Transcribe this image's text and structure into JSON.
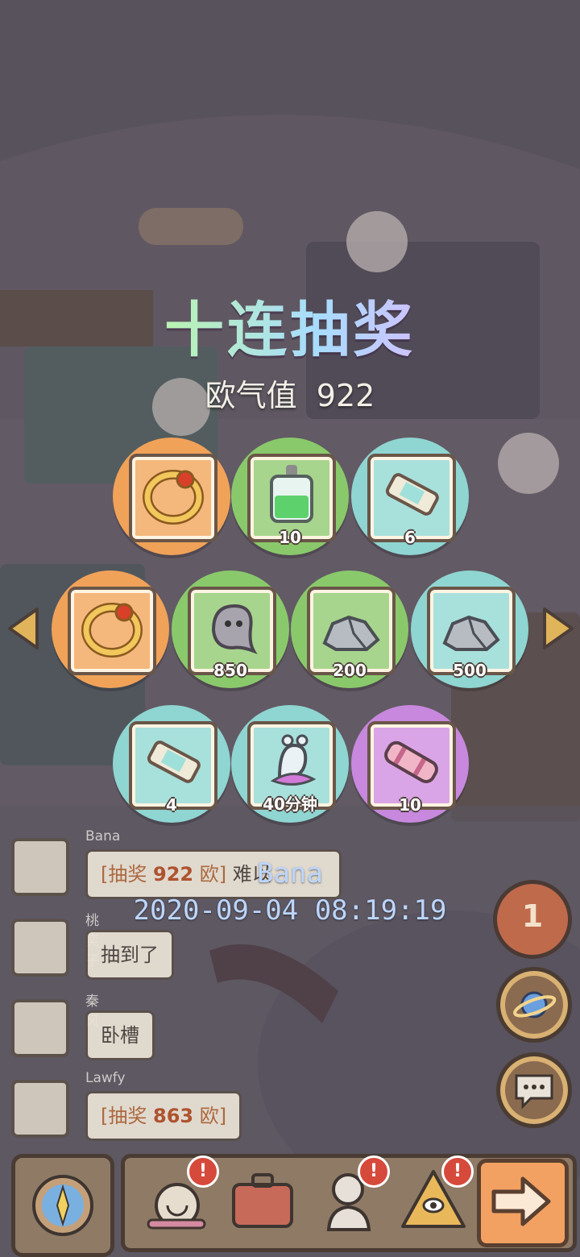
{
  "title": "十连抽奖",
  "luck": {
    "label": "欧气值",
    "value": "922"
  },
  "rewards": [
    {
      "item": "ring",
      "color": "orange",
      "qty": ""
    },
    {
      "item": "potion",
      "color": "green",
      "qty": "10"
    },
    {
      "item": "scroll",
      "color": "teal",
      "qty": "6"
    },
    {
      "item": "ring",
      "color": "orange",
      "qty": ""
    },
    {
      "item": "slime",
      "color": "green",
      "qty": "850"
    },
    {
      "item": "stone",
      "color": "green",
      "qty": "200"
    },
    {
      "item": "stone",
      "color": "teal",
      "qty": "500"
    },
    {
      "item": "scroll",
      "color": "teal",
      "qty": "4"
    },
    {
      "item": "snail",
      "color": "teal",
      "qty": "40分钟"
    },
    {
      "item": "cannon",
      "color": "purple",
      "qty": "10"
    }
  ],
  "chat": [
    {
      "name": "Bana",
      "tag_open": "[抽奖",
      "num": "922",
      "tag_close": "欧]",
      "text": " 难以"
    },
    {
      "name": "桃奕子",
      "text": "抽到了"
    },
    {
      "name": "秦风",
      "text": "卧槽"
    },
    {
      "name": "Lawfy",
      "tag_open": "[抽奖",
      "num": "863",
      "tag_close": "欧]"
    }
  ],
  "watermark": {
    "user": "Bana",
    "timestamp": "2020-09-04  08:19:19"
  },
  "badge_count": "1",
  "icons": {
    "prev": "left-arrow-icon",
    "next": "right-arrow-icon",
    "side": [
      "planet-icon",
      "chat-icon"
    ],
    "bottom": [
      "compass-icon",
      "snail-icon",
      "suitcase-icon",
      "statue-icon",
      "pyramid-icon",
      "go-arrow-icon"
    ]
  },
  "colors": {
    "orange": "#f0a259",
    "green": "#8ac96b",
    "teal": "#8fd5d2",
    "purple": "#c788dd"
  }
}
